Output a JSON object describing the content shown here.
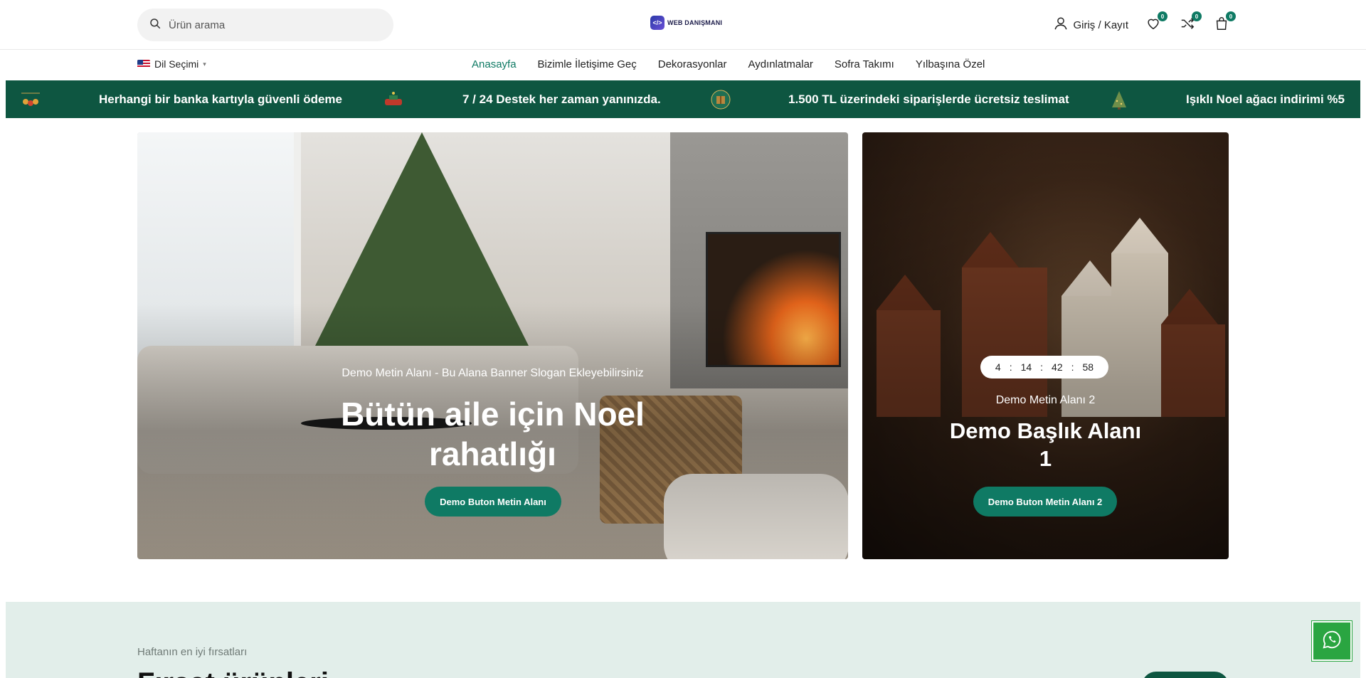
{
  "header": {
    "search_placeholder": "Ürün arama",
    "logo_mark": "</>",
    "logo_text": "WEB DANIŞMANI",
    "account_label": "Giriş / Kayıt",
    "wishlist_count": "0",
    "compare_count": "0",
    "cart_count": "0"
  },
  "nav": {
    "language_label": "Dil Seçimi",
    "links": [
      {
        "label": "Anasayfa",
        "active": true
      },
      {
        "label": "Bizimle İletişime Geç",
        "active": false
      },
      {
        "label": "Dekorasyonlar",
        "active": false
      },
      {
        "label": "Aydınlatmalar",
        "active": false
      },
      {
        "label": "Sofra Takımı",
        "active": false
      },
      {
        "label": "Yılbaşına Özel",
        "active": false
      }
    ]
  },
  "ticker": {
    "items": [
      {
        "text": "Herhangi bir banka kartıyla güvenli ödeme",
        "icon": "ornaments-icon"
      },
      {
        "text": "7 / 24 Destek her zaman yanınızda.",
        "icon": "sleigh-icon"
      },
      {
        "text": "1.500 TL üzerindeki siparişlerde ücretsiz teslimat",
        "icon": "gift-box-icon"
      },
      {
        "text": "Işıklı Noel ağacı indirimi %5",
        "icon": "christmas-tree-icon"
      }
    ]
  },
  "banner_main": {
    "slogan": "Demo Metin Alanı - Bu Alana Banner Slogan Ekleyebilirsiniz",
    "title_line1": "Bütün aile için Noel",
    "title_line2": "rahatlığı",
    "button_label": "Demo Buton Metin Alanı"
  },
  "banner_side": {
    "countdown": {
      "days": "4",
      "hours": "14",
      "minutes": "42",
      "seconds": "58",
      "separator": ":"
    },
    "subtitle": "Demo Metin Alanı 2",
    "title_line1": "Demo Başlık Alanı",
    "title_line2": "1",
    "button_label": "Demo Buton Metin Alanı 2"
  },
  "deals": {
    "subtitle": "Haftanın en iyi fırsatları",
    "title": "Fırsat ürünleri"
  },
  "colors": {
    "accent": "#0f7a64",
    "ticker_bg": "#0e5641",
    "deals_bg": "#e2eeea",
    "whatsapp": "#2aa541"
  }
}
